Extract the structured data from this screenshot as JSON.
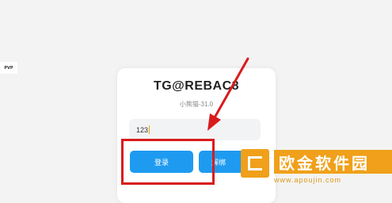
{
  "game_logo": "PVP",
  "dialog": {
    "title": "TG@REBAC8",
    "subtitle": "小熊猫-31.0",
    "input_value": "123",
    "login_label": "登录",
    "unbind_label": "解绑"
  },
  "colors": {
    "button": "#1e9bf0",
    "highlight": "#d81c1c",
    "watermark": "#f0a01a"
  },
  "watermark": {
    "brand": "欧金软件园",
    "url": "www.apoujin.com"
  }
}
